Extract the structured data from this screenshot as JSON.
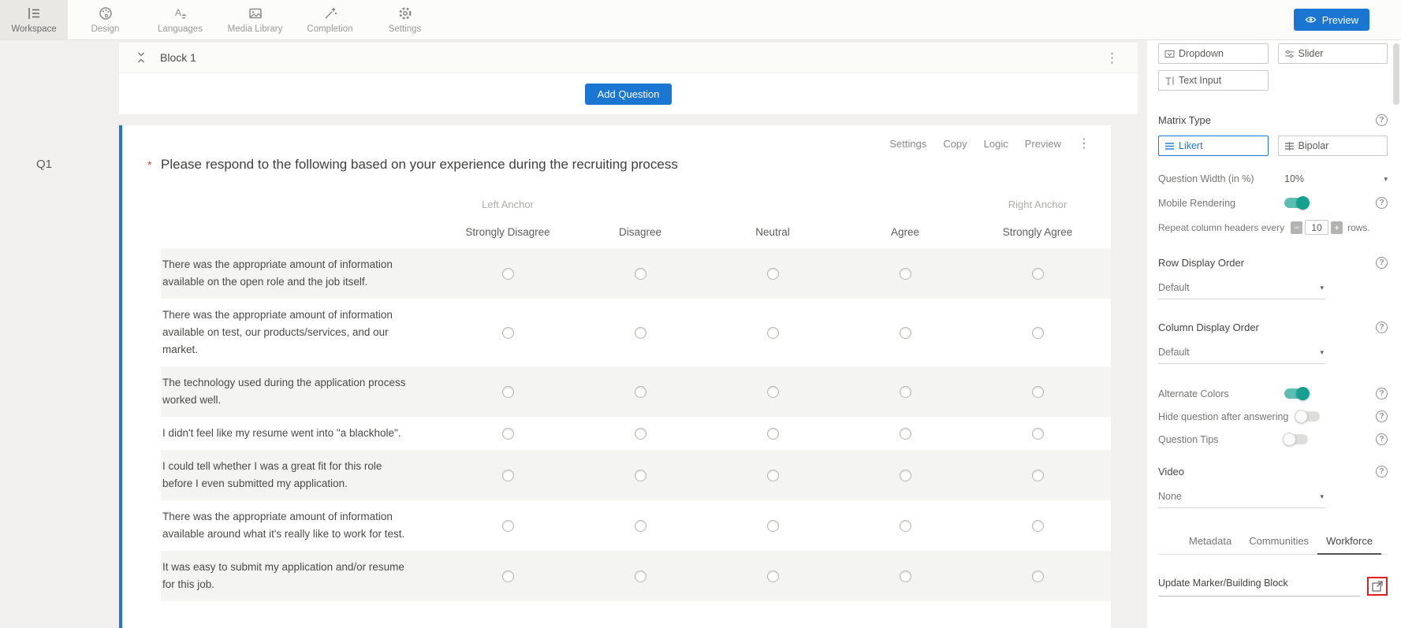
{
  "topbar": {
    "items": [
      {
        "label": "Workspace",
        "icon": "workspace-icon",
        "active": true
      },
      {
        "label": "Design",
        "icon": "design-icon",
        "active": false
      },
      {
        "label": "Languages",
        "icon": "languages-icon",
        "active": false
      },
      {
        "label": "Media Library",
        "icon": "media-library-icon",
        "active": false
      },
      {
        "label": "Completion",
        "icon": "completion-icon",
        "active": false
      },
      {
        "label": "Settings",
        "icon": "settings-icon",
        "active": false
      }
    ],
    "preview": {
      "label": "Preview",
      "icon": "eye-icon"
    }
  },
  "canvas": {
    "question_id_label": "Q1",
    "block_title": "Block 1",
    "add_question_label": "Add Question",
    "question": {
      "actions": [
        {
          "label": "Settings"
        },
        {
          "label": "Copy"
        },
        {
          "label": "Logic"
        },
        {
          "label": "Preview"
        }
      ],
      "required_marker": "*",
      "title": "Please respond to the following based on your experience during the recruiting process",
      "matrix": {
        "left_anchor": "Left Anchor",
        "right_anchor": "Right Anchor",
        "columns": [
          "Strongly Disagree",
          "Disagree",
          "Neutral",
          "Agree",
          "Strongly Agree"
        ],
        "rows": [
          "There was the appropriate amount of information available on the open role and the job itself.",
          "There was the appropriate amount of information available on test, our products/services, and our market.",
          "The technology used during the application process worked well.",
          "I didn't feel like my resume went into \"a blackhole\".",
          "I could tell whether I was a great fit for this role before I even submitted my application.",
          "There was the appropriate amount of information available around what it's really like to work for test.",
          "It was easy to submit my application and/or resume for this job."
        ]
      }
    }
  },
  "panel": {
    "type_buttons": [
      {
        "label": "Dropdown",
        "icon": "dropdown-type-icon"
      },
      {
        "label": "Slider",
        "icon": "slider-type-icon"
      },
      {
        "label": "Text Input",
        "icon": "text-input-type-icon"
      }
    ],
    "matrix_type": {
      "label": "Matrix Type",
      "options": [
        {
          "label": "Likert",
          "selected": true
        },
        {
          "label": "Bipolar",
          "selected": false
        }
      ]
    },
    "question_width": {
      "label": "Question Width (in %)",
      "value": "10%"
    },
    "mobile_rendering": {
      "label": "Mobile Rendering",
      "on": true
    },
    "repeat_headers": {
      "label": "Repeat column headers every",
      "value": "10",
      "suffix": "rows."
    },
    "row_display_order": {
      "label": "Row Display Order",
      "value": "Default"
    },
    "column_display_order": {
      "label": "Column Display Order",
      "value": "Default"
    },
    "alternate_colors": {
      "label": "Alternate Colors",
      "on": true
    },
    "hide_question": {
      "label": "Hide question after answering",
      "on": false
    },
    "question_tips": {
      "label": "Question Tips",
      "on": false
    },
    "video": {
      "label": "Video",
      "value": "None"
    },
    "tabs": [
      {
        "label": "Metadata",
        "active": false
      },
      {
        "label": "Communities",
        "active": false
      },
      {
        "label": "Workforce",
        "active": true
      }
    ],
    "update_link": "Update Marker/Building Block"
  },
  "icons": {
    "kebab": "⋮",
    "help": "?",
    "caret_down": "▾",
    "minus": "−",
    "plus": "+"
  },
  "colors": {
    "accent_blue": "#1b76d2",
    "toggle_teal": "#17a08f",
    "highlight_red": "#e02020",
    "alt_row": "#f4f4f2"
  }
}
